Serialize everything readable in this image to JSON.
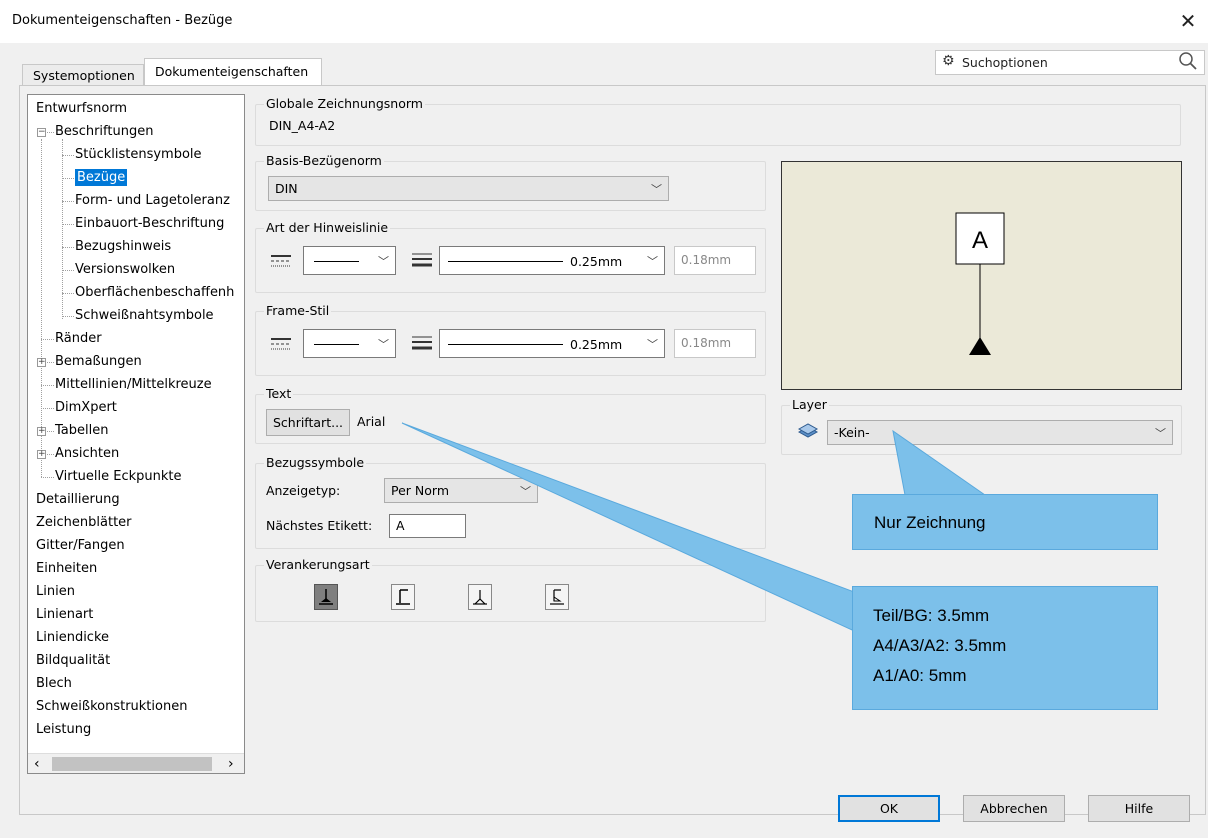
{
  "window": {
    "title": "Dokumenteigenschaften - Bezüge",
    "close": "✕"
  },
  "tabs": [
    {
      "label": "Systemoptionen",
      "active": false
    },
    {
      "label": "Dokumenteigenschaften",
      "active": true
    }
  ],
  "search": {
    "label": "Suchoptionen"
  },
  "tree": {
    "items": [
      {
        "label": "Entwurfsnorm",
        "level": 0
      },
      {
        "label": "Beschriftungen",
        "level": 1,
        "expander": "−"
      },
      {
        "label": "Stücklistensymbole",
        "level": 2
      },
      {
        "label": "Bezüge",
        "level": 2,
        "selected": true
      },
      {
        "label": "Form- und Lagetoleranz",
        "level": 2
      },
      {
        "label": "Einbauort-Beschriftung",
        "level": 2
      },
      {
        "label": "Bezugshinweis",
        "level": 2
      },
      {
        "label": "Versionswolken",
        "level": 2
      },
      {
        "label": "Oberflächenbeschaffenh",
        "level": 2
      },
      {
        "label": "Schweißnahtsymbole",
        "level": 2
      },
      {
        "label": "Ränder",
        "level": 1
      },
      {
        "label": "Bemaßungen",
        "level": 1,
        "expander": "+"
      },
      {
        "label": "Mittellinien/Mittelkreuze",
        "level": 1
      },
      {
        "label": "DimXpert",
        "level": 1
      },
      {
        "label": "Tabellen",
        "level": 1,
        "expander": "+"
      },
      {
        "label": "Ansichten",
        "level": 1,
        "expander": "+"
      },
      {
        "label": "Virtuelle Eckpunkte",
        "level": 1
      },
      {
        "label": "Detaillierung",
        "level": 0
      },
      {
        "label": "Zeichenblätter",
        "level": 0
      },
      {
        "label": "Gitter/Fangen",
        "level": 0
      },
      {
        "label": "Einheiten",
        "level": 0
      },
      {
        "label": "Linien",
        "level": 0
      },
      {
        "label": "Linienart",
        "level": 0
      },
      {
        "label": "Liniendicke",
        "level": 0
      },
      {
        "label": "Bildqualität",
        "level": 0
      },
      {
        "label": "Blech",
        "level": 0
      },
      {
        "label": "Schweißkonstruktionen",
        "level": 0
      },
      {
        "label": "Leistung",
        "level": 0
      }
    ]
  },
  "global_norm": {
    "title": "Globale Zeichnungsnorm",
    "value": "DIN_A4-A2"
  },
  "basis_norm": {
    "title": "Basis-Bezügenorm",
    "value": "DIN"
  },
  "leader_style": {
    "title": "Art der Hinweislinie",
    "thickness": "0.25mm",
    "custom": "0.18mm"
  },
  "frame_style": {
    "title": "Frame-Stil",
    "thickness": "0.25mm",
    "custom": "0.18mm"
  },
  "text": {
    "title": "Text",
    "font_button": "Schriftart...",
    "font_name": "Arial"
  },
  "datum_symbols": {
    "title": "Bezugssymbole",
    "display_type_label": "Anzeigetyp:",
    "display_type_value": "Per Norm",
    "next_label_label": "Nächstes Etikett:",
    "next_label_value": "A"
  },
  "anchor": {
    "title": "Verankerungsart"
  },
  "preview": {
    "letter": "A"
  },
  "layer": {
    "title": "Layer",
    "value": "-Kein-"
  },
  "callouts": {
    "drawing_only": "Nur Zeichnung",
    "sizes": [
      "Teil/BG: 3.5mm",
      "A4/A3/A2: 3.5mm",
      "A1/A0: 5mm"
    ]
  },
  "buttons": {
    "ok": "OK",
    "cancel": "Abbrechen",
    "help": "Hilfe"
  },
  "colors": {
    "selection": "#0078d7",
    "callout": "#7cc0ea",
    "preview_bg": "#ebe9d8"
  }
}
